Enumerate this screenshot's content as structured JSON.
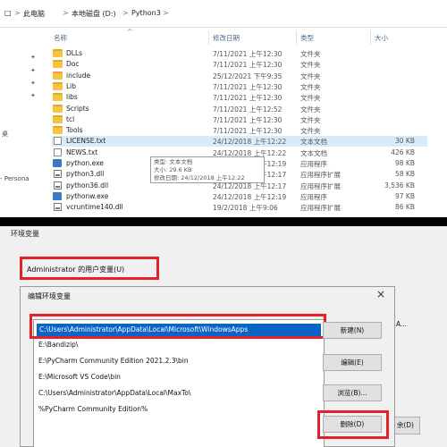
{
  "explorer": {
    "breadcrumb": [
      "此电脑",
      "本地磁盘 (D:)",
      "Python3"
    ],
    "breadcrumb_sep": ">",
    "columns": {
      "name": "名称",
      "date": "修改日期",
      "type": "类型",
      "size": "大小"
    },
    "sort_indicator": "^",
    "files": [
      {
        "name": "DLLs",
        "date": "7/11/2021 上午12:30",
        "type": "文件夹",
        "size": "",
        "icon": "folder-icon"
      },
      {
        "name": "Doc",
        "date": "7/11/2021 上午12:30",
        "type": "文件夹",
        "size": "",
        "icon": "folder-icon"
      },
      {
        "name": "include",
        "date": "25/12/2021 下午9:35",
        "type": "文件夹",
        "size": "",
        "icon": "folder-icon"
      },
      {
        "name": "Lib",
        "date": "7/11/2021 上午12:30",
        "type": "文件夹",
        "size": "",
        "icon": "folder-icon"
      },
      {
        "name": "libs",
        "date": "7/11/2021 上午12:30",
        "type": "文件夹",
        "size": "",
        "icon": "folder-icon"
      },
      {
        "name": "Scripts",
        "date": "7/11/2021 上午12:52",
        "type": "文件夹",
        "size": "",
        "icon": "folder-icon"
      },
      {
        "name": "tcl",
        "date": "7/11/2021 上午12:30",
        "type": "文件夹",
        "size": "",
        "icon": "folder-icon"
      },
      {
        "name": "Tools",
        "date": "7/11/2021 上午12:30",
        "type": "文件夹",
        "size": "",
        "icon": "folder-icon"
      },
      {
        "name": "LICENSE.txt",
        "date": "24/12/2018 上午12:22",
        "type": "文本文档",
        "size": "30 KB",
        "icon": "text-file-icon"
      },
      {
        "name": "NEWS.txt",
        "date": "24/12/2018 上午12:22",
        "type": "文本文档",
        "size": "426 KB",
        "icon": "text-file-icon"
      },
      {
        "name": "python.exe",
        "date": "24/12/2018 上午12:19",
        "type": "应用程序",
        "size": "98 KB",
        "icon": "exe-icon"
      },
      {
        "name": "python3.dll",
        "date": "24/12/2018 上午12:17",
        "type": "应用程序扩展",
        "size": "58 KB",
        "icon": "dll-icon"
      },
      {
        "name": "python36.dll",
        "date": "24/12/2018 上午12:17",
        "type": "应用程序扩展",
        "size": "3,536 KB",
        "icon": "dll-icon"
      },
      {
        "name": "pythonw.exe",
        "date": "24/12/2018 上午12:19",
        "type": "应用程序",
        "size": "97 KB",
        "icon": "exe-icon"
      },
      {
        "name": "vcruntime140.dll",
        "date": "19/2/2018 上午9:06",
        "type": "应用程序扩展",
        "size": "86 KB",
        "icon": "dll-icon"
      }
    ],
    "tooltip": [
      "类型: 文本文档",
      "大小: 29.6 KB",
      "修改日期: 24/12/2018 上午12:22"
    ],
    "sidebar_fragment_1": "桌",
    "sidebar_fragment_2": "- Persona"
  },
  "env": {
    "title": "环境变量",
    "user_vars_label": "Administrator 的用户变量(U)",
    "edit_dialog": {
      "title": "编辑环境变量",
      "close": "×",
      "paths": [
        "C:\\Users\\Administrator\\AppData\\Local\\Microsoft\\WindowsApps",
        "E:\\Bandizip\\",
        "E:\\PyCharm Community Edition 2021.2.3\\bin",
        "E:\\Microsoft VS Code\\bin",
        "C:\\Users\\Administrator\\AppData\\Local\\MaxTo\\",
        "%PyCharm Community Edition%"
      ],
      "buttons": {
        "new": "新建(N)",
        "edit": "编辑(E)",
        "browse": "浏览(B)...",
        "delete": "删除(D)"
      }
    },
    "right_fragment": "A...",
    "right_cancel": "余(D)"
  },
  "colors": {
    "highlight": "#e4202a",
    "selection": "#0a64c8"
  }
}
